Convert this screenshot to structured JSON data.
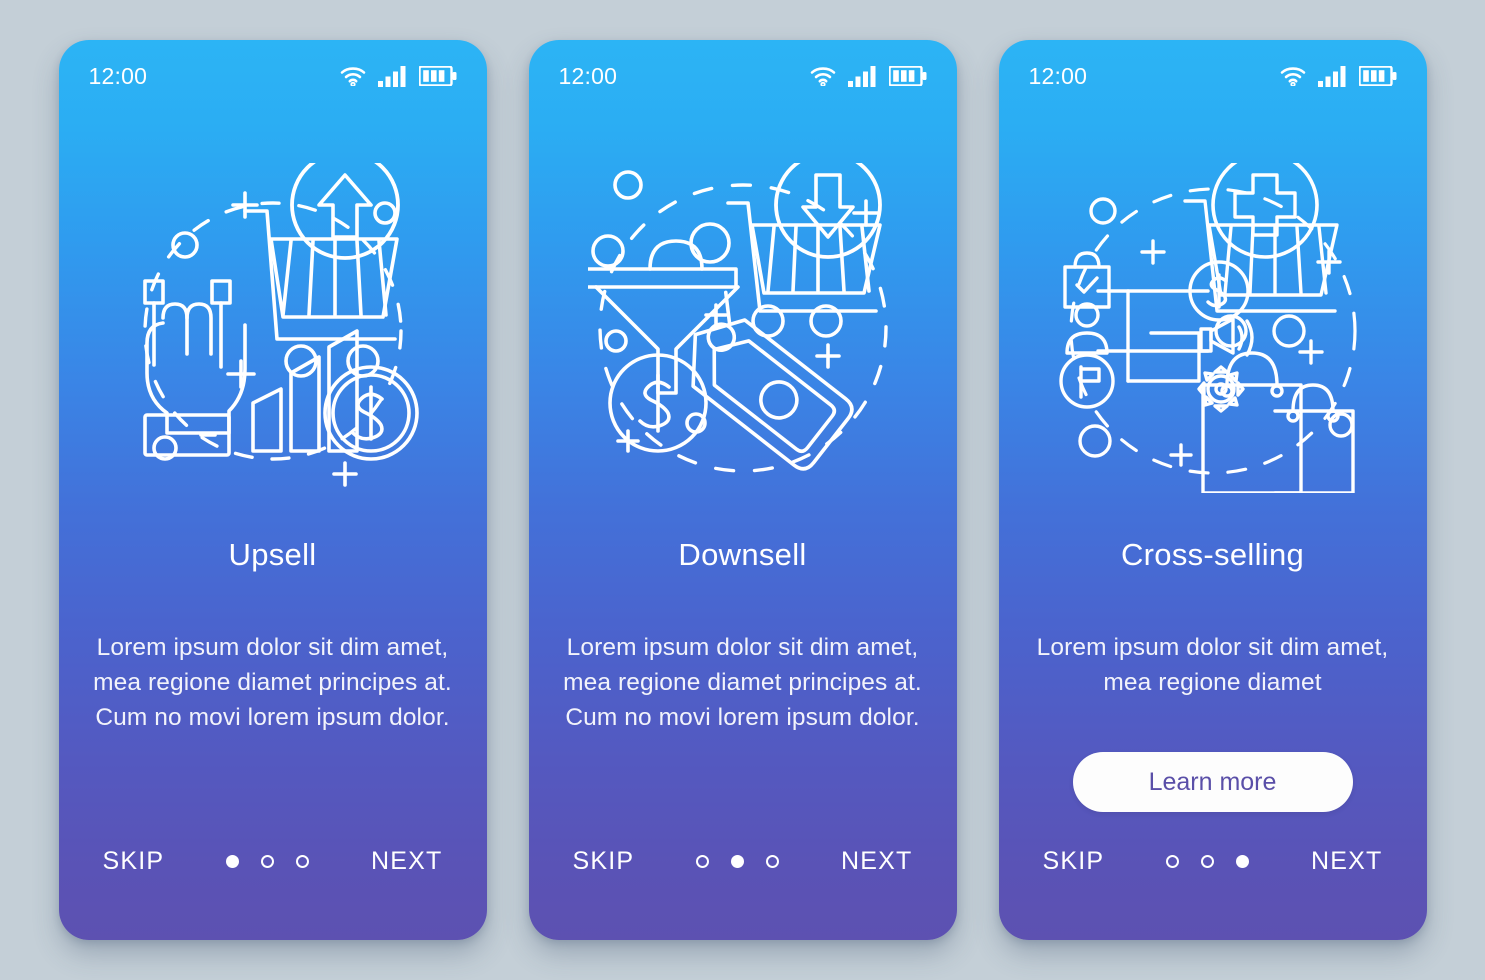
{
  "background_color": "#c4cfd7",
  "theme": {
    "gradient_top": "#2cb4f5",
    "gradient_bottom": "#5d51b1",
    "accent_button_bg": "#fdfdfd",
    "accent_button_text": "#5a4fa8",
    "stroke_color": "#ffffff"
  },
  "screens": [
    {
      "status": {
        "time": "12:00",
        "icons": [
          "wifi-icon",
          "signal-icon",
          "battery-icon"
        ]
      },
      "illustration": "upsell-illustration",
      "illustration_parts": [
        "hand-rock-gesture-icon",
        "shopping-cart-icon",
        "up-arrow-circle-icon",
        "bar-chart-icon",
        "dollar-coin-icon",
        "dashed-circle",
        "plus-marks",
        "small-circles"
      ],
      "title": "Upsell",
      "body": "Lorem ipsum dolor sit dim amet, mea regione diamet principes at. Cum no movi lorem ipsum dolor.",
      "has_button": false,
      "button_label": "",
      "skip_label": "SKIP",
      "next_label": "NEXT",
      "dots": [
        "active",
        "inactive",
        "inactive"
      ]
    },
    {
      "status": {
        "time": "12:00",
        "icons": [
          "wifi-icon",
          "signal-icon",
          "battery-icon"
        ]
      },
      "illustration": "downsell-illustration",
      "illustration_parts": [
        "funnel-icon",
        "shopping-cart-icon",
        "down-arrow-circle-icon",
        "dollar-coin-icon",
        "price-tag-icon",
        "dashed-circle",
        "plus-marks",
        "small-circles"
      ],
      "title": "Downsell",
      "body": "Lorem ipsum dolor sit dim amet, mea regione diamet principes at. Cum no movi lorem ipsum dolor.",
      "has_button": false,
      "button_label": "",
      "skip_label": "SKIP",
      "next_label": "NEXT",
      "dots": [
        "inactive",
        "active",
        "inactive"
      ]
    },
    {
      "status": {
        "time": "12:00",
        "icons": [
          "wifi-icon",
          "signal-icon",
          "battery-icon"
        ]
      },
      "illustration": "cross-selling-illustration",
      "illustration_parts": [
        "shopping-cart-icon",
        "plus-circle-icon",
        "shopping-bags-icon",
        "checklist-icon",
        "user-icon",
        "flag-circle-icon",
        "dollar-circle-icon",
        "megaphone-icon",
        "gear-icon",
        "network-lines",
        "dashed-circle",
        "plus-marks",
        "small-circles"
      ],
      "title": "Cross-selling",
      "body": "Lorem ipsum dolor sit dim amet, mea regione diamet",
      "has_button": true,
      "button_label": "Learn more",
      "skip_label": "SKIP",
      "next_label": "NEXT",
      "dots": [
        "inactive",
        "inactive",
        "active"
      ]
    }
  ]
}
